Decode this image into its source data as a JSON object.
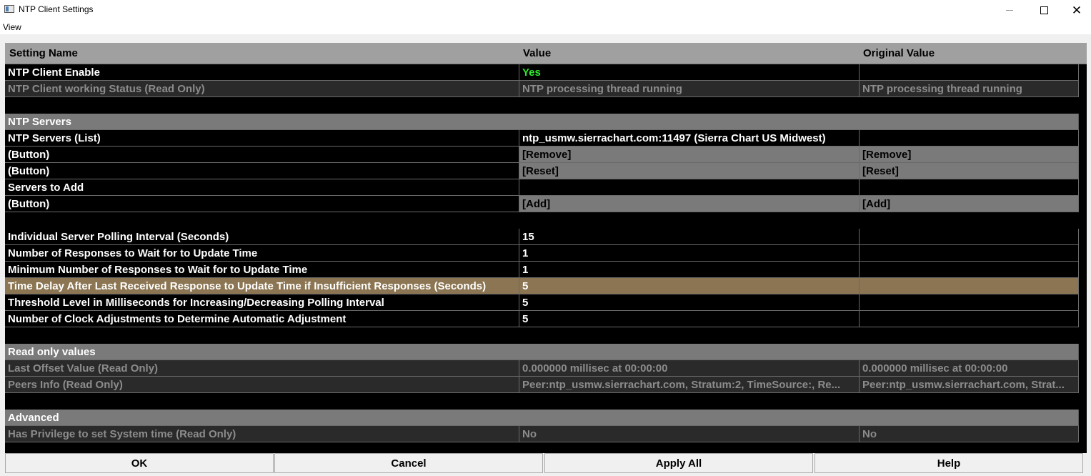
{
  "window": {
    "title": "NTP Client Settings",
    "menu": [
      "View"
    ]
  },
  "grid": {
    "columns": [
      "Setting Name",
      "Value",
      "Original Value"
    ],
    "rows": [
      {
        "type": "normal",
        "name": "NTP Client Enable",
        "value": "Yes",
        "original": ""
      },
      {
        "type": "readonly",
        "name": "NTP Client working Status (Read Only)",
        "value": "NTP processing thread running",
        "original": "NTP processing thread running"
      },
      {
        "type": "blank"
      },
      {
        "type": "section",
        "name": "NTP Servers"
      },
      {
        "type": "normal",
        "name": "NTP Servers (List)",
        "value": "ntp_usmw.sierrachart.com:11497 (Sierra Chart US Midwest)",
        "original": ""
      },
      {
        "type": "button",
        "name": " (Button)",
        "value": "[Remove]",
        "original": "[Remove]"
      },
      {
        "type": "button",
        "name": " (Button)",
        "value": "[Reset]",
        "original": "[Reset]"
      },
      {
        "type": "normal",
        "name": "Servers to Add",
        "value": "",
        "original": ""
      },
      {
        "type": "button",
        "name": " (Button)",
        "value": "[Add]",
        "original": "[Add]"
      },
      {
        "type": "blank"
      },
      {
        "type": "normal",
        "name": "Individual Server Polling Interval (Seconds)",
        "value": "15",
        "original": ""
      },
      {
        "type": "normal",
        "name": "Number of Responses to Wait for to Update Time",
        "value": "1",
        "original": ""
      },
      {
        "type": "normal",
        "name": "Minimum Number of Responses to Wait for to Update Time",
        "value": "1",
        "original": ""
      },
      {
        "type": "highlight",
        "name": "Time Delay After Last Received Response to Update Time if Insufficient Responses (Seconds)",
        "value": "5",
        "original": ""
      },
      {
        "type": "normal",
        "name": "Threshold Level in Milliseconds for Increasing/Decreasing Polling Interval",
        "value": "5",
        "original": ""
      },
      {
        "type": "normal",
        "name": "Number of Clock Adjustments to Determine Automatic Adjustment",
        "value": "5",
        "original": ""
      },
      {
        "type": "blank"
      },
      {
        "type": "section",
        "name": "Read only values"
      },
      {
        "type": "readonly",
        "name": "Last Offset Value (Read Only)",
        "value": "0.000000 millisec at 00:00:00",
        "original": "0.000000 millisec at 00:00:00"
      },
      {
        "type": "readonly",
        "name": "Peers Info (Read Only)",
        "value": "Peer:ntp_usmw.sierrachart.com, Stratum:2, TimeSource:, Re...",
        "original": "Peer:ntp_usmw.sierrachart.com, Strat..."
      },
      {
        "type": "blank"
      },
      {
        "type": "section",
        "name": "Advanced"
      },
      {
        "type": "readonly",
        "name": "Has Privilege to set System time (Read Only)",
        "value": "No",
        "original": "No"
      }
    ]
  },
  "buttons": {
    "ok": "OK",
    "cancel": "Cancel",
    "apply_all": "Apply All",
    "help": "Help"
  }
}
